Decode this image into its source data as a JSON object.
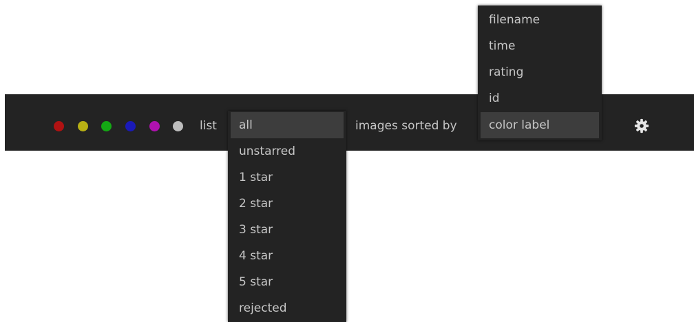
{
  "toolbar": {
    "color_labels": [
      {
        "name": "red",
        "color": "#b01212"
      },
      {
        "name": "yellow",
        "color": "#b8b014"
      },
      {
        "name": "green",
        "color": "#14a814"
      },
      {
        "name": "blue",
        "color": "#1a1ab8"
      },
      {
        "name": "magenta",
        "color": "#b012b0"
      },
      {
        "name": "white",
        "color": "#bdbdbd"
      }
    ],
    "list_label": "list",
    "sort_label": "images sorted by",
    "settings_icon": "gear-icon"
  },
  "rating_filter": {
    "selected": "all",
    "options": [
      "all",
      "unstarred",
      "1 star",
      "2 star",
      "3 star",
      "4 star",
      "5 star",
      "rejected"
    ]
  },
  "sort_menu": {
    "selected": "color label",
    "options": [
      "filename",
      "time",
      "rating",
      "id",
      "color label"
    ]
  },
  "colors": {
    "toolbar_bg": "#232323",
    "text": "#c6c6c6",
    "selected_bg": "#3d3d3d"
  }
}
